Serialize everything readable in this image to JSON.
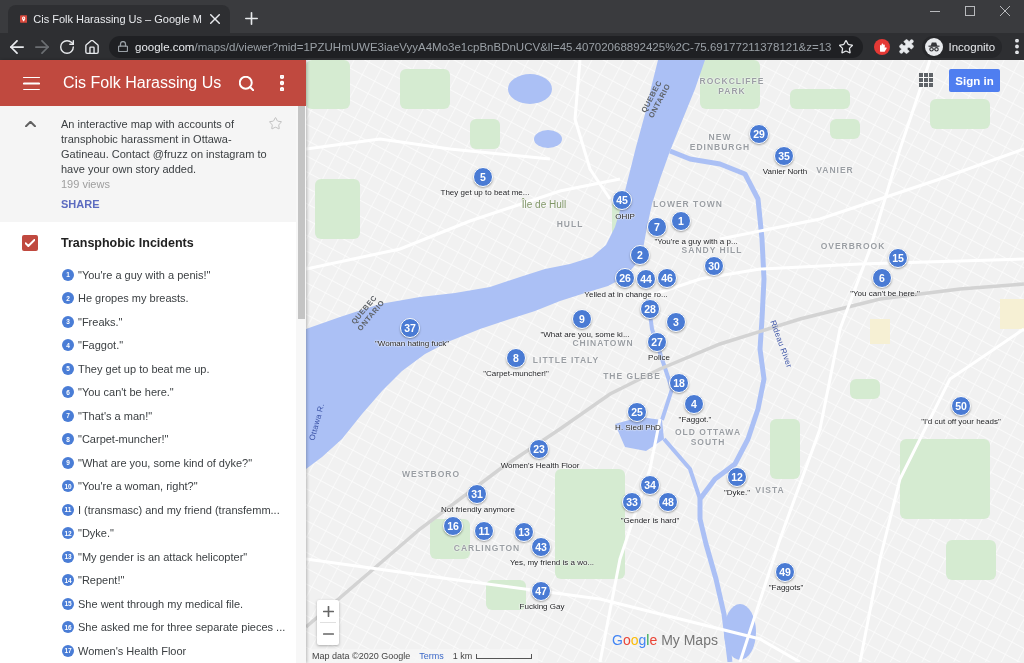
{
  "browser": {
    "tab_title": "Cis Folk Harassing Us – Google M",
    "address": {
      "host": "google.com",
      "path": "/maps/d/viewer?mid=1PZUHmUWE3iaeVyyA4Mo3e1cpBnBDnUCV&ll=45.40702068892425%2C-75.69177211378121&z=13"
    },
    "forward_disabled": true,
    "profile_label": "Incognito"
  },
  "sidebar": {
    "title": "Cis Folk Harassing Us",
    "details_expanded": true,
    "description": "An interactive map with accounts of transphobic harassment in Ottawa-Gatineau. Contact @fruzz on instagram to have your own story added.",
    "views": "199 views",
    "share": "SHARE",
    "layer": {
      "title": "Transphobic Incidents",
      "checked": true,
      "items": [
        {
          "number": "1",
          "title": "\"You're a guy with a penis!\""
        },
        {
          "number": "2",
          "title": "He gropes my breasts."
        },
        {
          "number": "3",
          "title": "\"Freaks.\""
        },
        {
          "number": "4",
          "title": "\"Faggot.\""
        },
        {
          "number": "5",
          "title": "They get up to beat me up."
        },
        {
          "number": "6",
          "title": "\"You can't be here.\""
        },
        {
          "number": "7",
          "title": "\"That's a man!\""
        },
        {
          "number": "8",
          "title": "\"Carpet-muncher!\""
        },
        {
          "number": "9",
          "title": "\"What are you, some kind of dyke?\""
        },
        {
          "number": "10",
          "title": "\"You're a woman, right?\""
        },
        {
          "number": "11",
          "title": "I (transmasc) and my friend (transfemm..."
        },
        {
          "number": "12",
          "title": "\"Dyke.\""
        },
        {
          "number": "13",
          "title": "\"My gender is an attack helicopter\""
        },
        {
          "number": "14",
          "title": "\"Repent!\""
        },
        {
          "number": "15",
          "title": "She went through my medical file."
        },
        {
          "number": "16",
          "title": "She asked me for three separate pieces ..."
        },
        {
          "number": "17",
          "title": "Women's Health Floor"
        }
      ]
    }
  },
  "map": {
    "sign_in": "Sign in",
    "place_labels": [
      {
        "kind": "border",
        "text": "QUEBEC ONTARIO"
      },
      {
        "kind": "district",
        "text": "ROCKCLIFFE PARK"
      },
      {
        "kind": "district",
        "text": "NEW EDINBURGH"
      },
      {
        "kind": "district",
        "text": "VANIER"
      },
      {
        "kind": "island",
        "text": "Île de Hull"
      },
      {
        "kind": "district",
        "text": "LOWER TOWN"
      },
      {
        "kind": "district",
        "text": "HULL"
      },
      {
        "kind": "district",
        "text": "SANDY HILL"
      },
      {
        "kind": "district",
        "text": "OVERBROOK"
      },
      {
        "kind": "border",
        "text": "QUEBEC ONTARIO"
      },
      {
        "kind": "district",
        "text": "CHINATOWN"
      },
      {
        "kind": "water",
        "text": "Rideau River"
      },
      {
        "kind": "district",
        "text": "LITTLE ITALY"
      },
      {
        "kind": "district",
        "text": "THE GLEBE"
      },
      {
        "kind": "water",
        "text": "Ottawa R."
      },
      {
        "kind": "district",
        "text": "OLD OTTAWA SOUTH"
      },
      {
        "kind": "district",
        "text": "WESTBORO"
      },
      {
        "kind": "district",
        "text": "VISTA"
      },
      {
        "kind": "district",
        "text": "CARLINGTON"
      }
    ],
    "markers": [
      {
        "number": "29"
      },
      {
        "number": "35",
        "label": "Vanier North"
      },
      {
        "number": "5",
        "label": "They get up to beat me..."
      },
      {
        "number": "45",
        "label": "OHIP"
      },
      {
        "number": "7"
      },
      {
        "number": "1",
        "label": "\"You're a guy with a p..."
      },
      {
        "number": "2"
      },
      {
        "number": "30"
      },
      {
        "number": "15"
      },
      {
        "number": "26"
      },
      {
        "number": "44",
        "label": "Yelled at in change ro..."
      },
      {
        "number": "46"
      },
      {
        "number": "6",
        "label": "\"You can't be here.\""
      },
      {
        "number": "28"
      },
      {
        "number": "37",
        "label": "\"Woman hating fuck\""
      },
      {
        "number": "9",
        "label": "\"What are you, some ki..."
      },
      {
        "number": "3"
      },
      {
        "number": "27",
        "label": "Police"
      },
      {
        "number": "8",
        "label": "\"Carpet-muncher!\""
      },
      {
        "number": "18"
      },
      {
        "number": "25",
        "label": "H. Siedl PhD"
      },
      {
        "number": "4",
        "label": "\"Faggot.\""
      },
      {
        "number": "50",
        "label": "\"I'd cut off your heads\""
      },
      {
        "number": "23",
        "label": "Women's Health Floor"
      },
      {
        "number": "12",
        "label": "\"Dyke.\""
      },
      {
        "number": "31",
        "label": "Not friendly anymore"
      },
      {
        "number": "34"
      },
      {
        "number": "33",
        "label": "\"Gender is hard\""
      },
      {
        "number": "48"
      },
      {
        "number": "16"
      },
      {
        "number": "11"
      },
      {
        "number": "13"
      },
      {
        "number": "43",
        "label": "Yes, my friend is a wo..."
      },
      {
        "number": "49",
        "label": "\"Faggots\""
      },
      {
        "number": "47",
        "label": "Fucking Gay"
      }
    ],
    "logo": {
      "brand": "Google",
      "product": "My Maps"
    },
    "attribution": "Map data ©2020 Google",
    "terms": "Terms",
    "scale": "1 km"
  }
}
